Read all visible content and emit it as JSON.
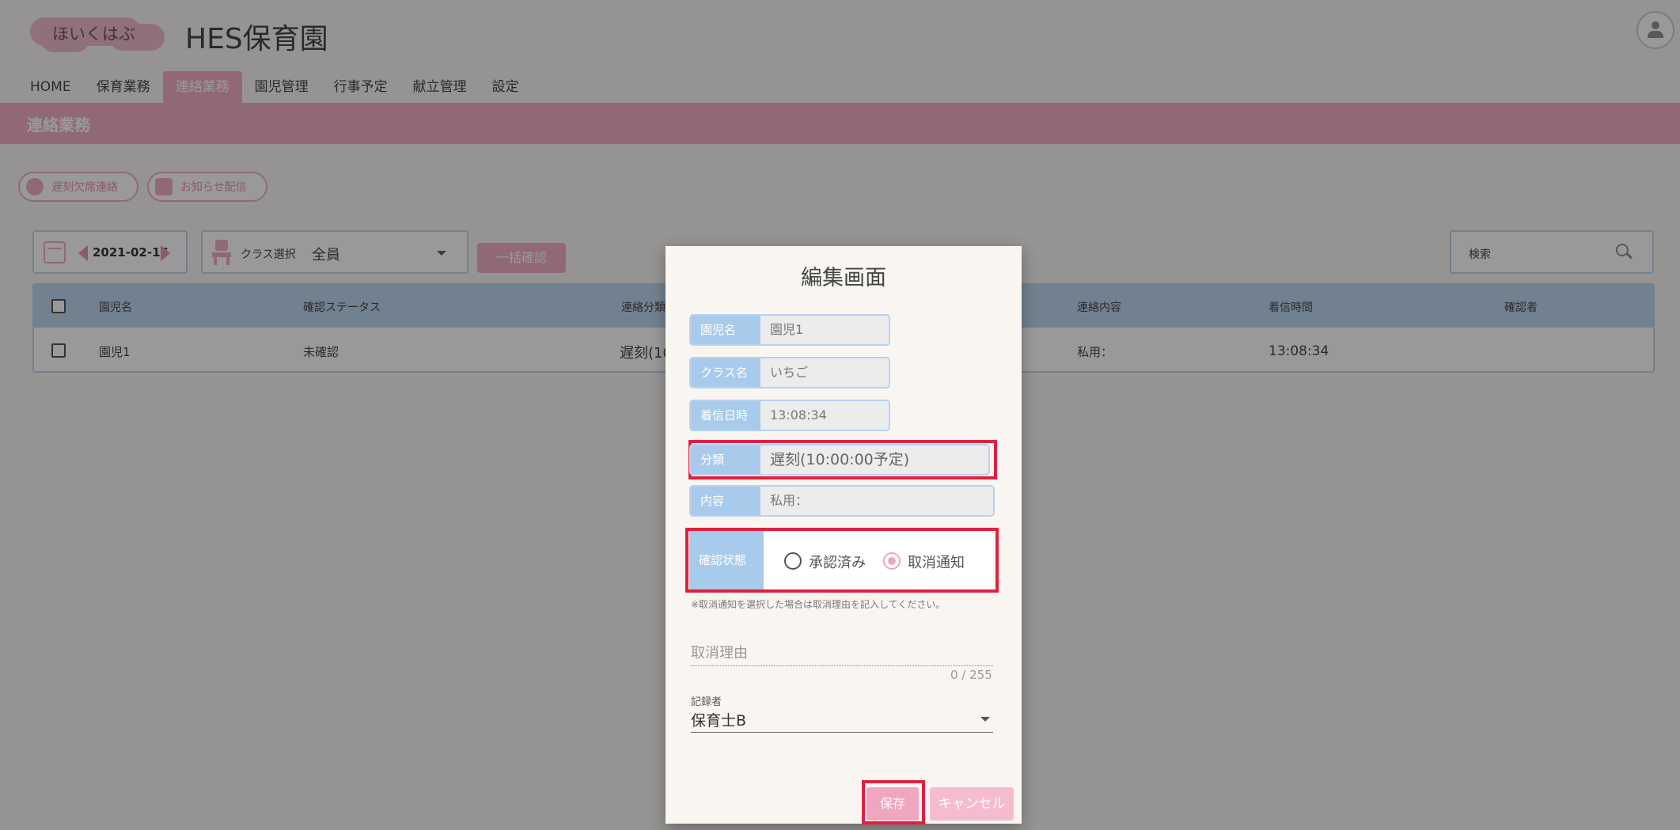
{
  "header": {
    "logo_text": "ほいくはぶ",
    "app_title": "HES保育園"
  },
  "nav": {
    "items": [
      "HOME",
      "保育業務",
      "連絡業務",
      "園児管理",
      "行事予定",
      "献立管理",
      "設定"
    ],
    "active": "連絡業務"
  },
  "section": {
    "title": "連絡業務"
  },
  "actions": {
    "absence_label": "遅刻欠席連絡",
    "notice_label": "お知らせ配信"
  },
  "filters": {
    "date": "2021-02-16",
    "class_label": "クラス選択",
    "class_value": "全員",
    "bulk_confirm_label": "一括確認",
    "search_label": "検索"
  },
  "table": {
    "headers": [
      "園児名",
      "確認ステータス",
      "連絡分類",
      "連絡内容",
      "着信時間",
      "確認者"
    ],
    "rows": [
      {
        "name": "園児1",
        "status": "未確認",
        "category": "遅刻(10",
        "content": "私用：",
        "time": "13:08:34",
        "confirmer": ""
      }
    ]
  },
  "modal": {
    "title": "編集画面",
    "fields": {
      "child_name": {
        "label": "園児名",
        "value": "園児1"
      },
      "class_name": {
        "label": "クラス名",
        "value": "いちご"
      },
      "received": {
        "label": "着信日時",
        "value": "13:08:34"
      },
      "category": {
        "label": "分類",
        "value": "遅刻(10:00:00予定)"
      },
      "content": {
        "label": "内容",
        "value": "私用："
      }
    },
    "status": {
      "label": "確認状態",
      "options": [
        "承認済み",
        "取消通知"
      ],
      "selected": "取消通知"
    },
    "note": "※取消通知を選択した場合は取消理由を記入してください。",
    "reason_placeholder": "取消理由",
    "counter": "0 / 255",
    "recorder_label": "記録者",
    "recorder_value": "保育士B",
    "save_label": "保存",
    "cancel_label": "キャンセル"
  },
  "colors": {
    "accent_pink": "#f0a6bf",
    "header_blue": "#b8d2ef",
    "highlight_red": "#e02040"
  }
}
